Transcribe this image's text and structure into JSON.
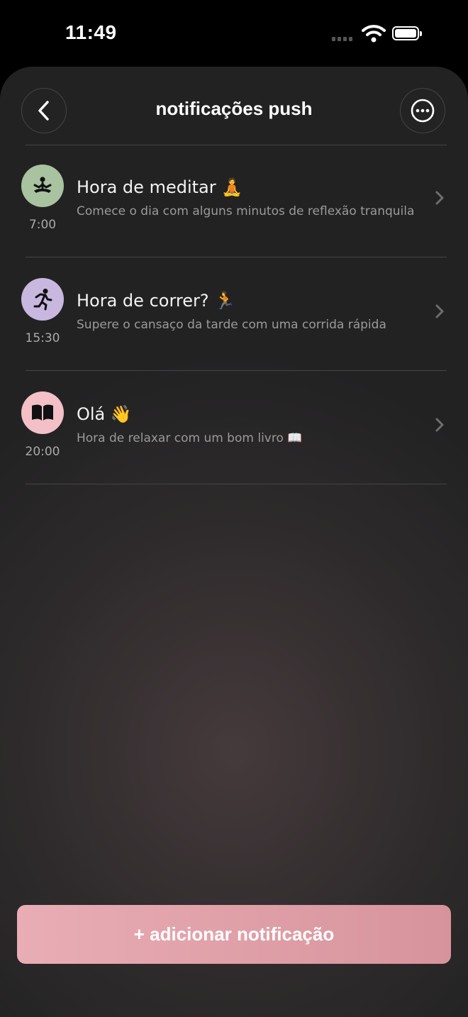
{
  "status_bar": {
    "time": "11:49"
  },
  "header": {
    "title": "notificações push"
  },
  "notifications": [
    {
      "title": "Hora de meditar 🧘",
      "subtitle": "Comece o dia com alguns minutos de reflexão tranquila",
      "time": "7:00",
      "icon": "meditation-icon",
      "color": "#a9c29f"
    },
    {
      "title": "Hora de correr? 🏃",
      "subtitle": "Supere o cansaço da tarde com uma corrida rápida",
      "time": "15:30",
      "icon": "running-icon",
      "color": "#c8b8e0"
    },
    {
      "title": "Olá 👋",
      "subtitle": "Hora de relaxar com um bom livro 📖",
      "time": "20:00",
      "icon": "book-icon",
      "color": "#f2c0c6"
    }
  ],
  "add_button": {
    "label": "+ adicionar notificação"
  },
  "colors": {
    "accent": "#e1a1aa",
    "background": "#2d2a2b"
  }
}
